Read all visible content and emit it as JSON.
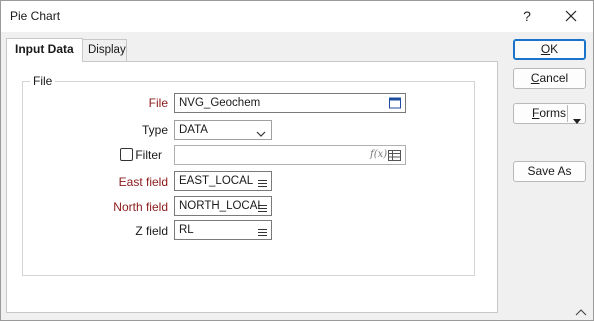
{
  "window": {
    "title": "Pie Chart",
    "help_label": "?"
  },
  "tabs": [
    {
      "label": "Input Data",
      "active": true
    },
    {
      "label": "Display",
      "active": false
    }
  ],
  "group": {
    "label": "File"
  },
  "fields": {
    "file": {
      "label": "File",
      "value": "NVG_Geochem"
    },
    "type": {
      "label": "Type",
      "value": "DATA"
    },
    "filter": {
      "label": "Filter",
      "value": "",
      "checked": false,
      "fx_label": "f(x)"
    },
    "east": {
      "label": "East field",
      "value": "EAST_LOCAL"
    },
    "north": {
      "label": "North field",
      "value": "NORTH_LOCAL"
    },
    "z": {
      "label": "Z field",
      "value": "RL"
    }
  },
  "buttons": {
    "ok_prefix": "",
    "ok_underline": "O",
    "ok_rest": "K",
    "cancel_underline": "C",
    "cancel_rest": "ancel",
    "forms_underline": "F",
    "forms_rest": "orms",
    "save_as": "Save As"
  },
  "colors": {
    "required_label": "#8b1a1a",
    "primary_border": "#1a73c9",
    "calendar_icon": "#1f4e9e"
  }
}
